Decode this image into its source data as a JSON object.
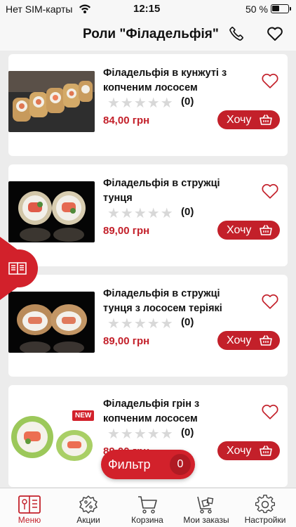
{
  "status": {
    "carrier": "Нет SIM-карты",
    "time": "12:15",
    "battery": "50 %"
  },
  "header": {
    "title": "Роли \"Філадельфія\""
  },
  "products": [
    {
      "name": "Філадельфія в кунжуті з копченим лососем",
      "rating_count": "(0)",
      "price": "84,00 грн",
      "button": "Хочу"
    },
    {
      "name": "Філадельфія в стружці тунця",
      "rating_count": "(0)",
      "price": "89,00 грн",
      "button": "Хочу"
    },
    {
      "name": "Філадельфія в стружці тунця з лососем теріякі",
      "rating_count": "(0)",
      "price": "89,00 грн",
      "button": "Хочу"
    },
    {
      "name": "Філадельфія грін з копченим лососем",
      "rating_count": "(0)",
      "price": "89,00 грн",
      "button": "Хочу",
      "badge": "NEW"
    }
  ],
  "filter": {
    "label": "Фильтр",
    "count": "0"
  },
  "tabbar": [
    {
      "label": "Меню",
      "icon": "menu-book-icon",
      "active": true
    },
    {
      "label": "Акции",
      "icon": "discount-badge-icon"
    },
    {
      "label": "Корзина",
      "icon": "cart-icon"
    },
    {
      "label": "Мои заказы",
      "icon": "orders-cart-icon"
    },
    {
      "label": "Настройки",
      "icon": "gear-icon"
    }
  ],
  "colors": {
    "accent": "#c3202a",
    "background": "#ececec"
  }
}
